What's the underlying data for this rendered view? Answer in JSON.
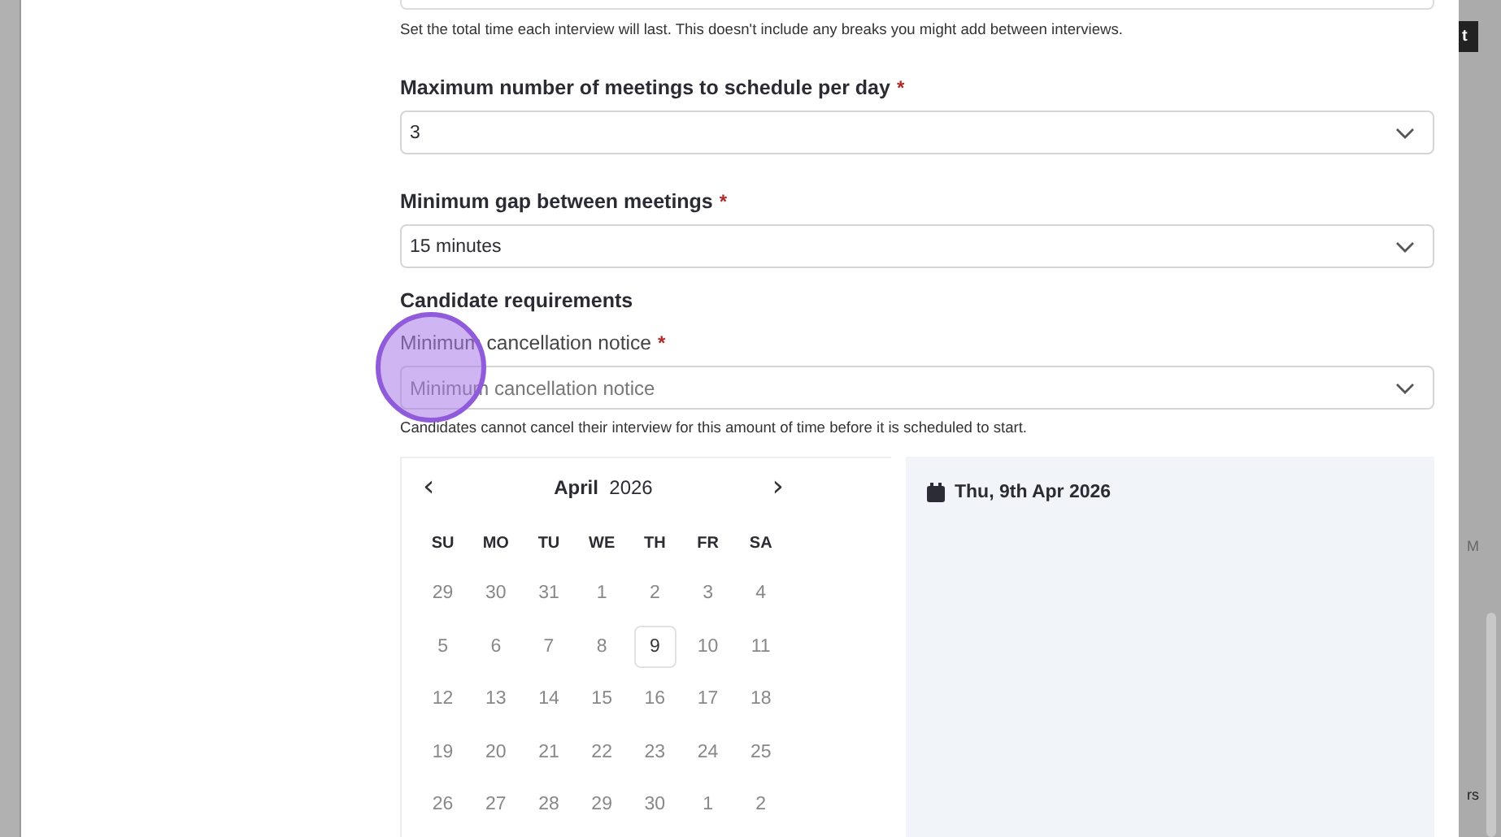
{
  "duration_hint": "Set the total time each interview will last. This doesn't include any breaks you might add between interviews.",
  "fields": [
    {
      "label": "Maximum number of meetings to schedule per day",
      "required_mark": "*",
      "value": "3"
    },
    {
      "label": "Minimum gap between meetings",
      "required_mark": "*",
      "value": "15 minutes"
    }
  ],
  "section_title": "Candidate requirements",
  "cancellation": {
    "label": "Minimum cancellation notice",
    "required_mark": "*",
    "placeholder": "Minimum cancellation notice",
    "hint": "Candidates cannot cancel their interview for this amount of time before it is scheduled to start."
  },
  "calendar": {
    "month": "April",
    "year": "2026",
    "prev": "‹",
    "next": "›",
    "weekdays": [
      "SU",
      "MO",
      "TU",
      "WE",
      "TH",
      "FR",
      "SA"
    ],
    "weeks": [
      [
        {
          "day": "29",
          "selected": false
        },
        {
          "day": "30",
          "selected": false
        },
        {
          "day": "31",
          "selected": false
        },
        {
          "day": "1",
          "selected": false
        },
        {
          "day": "2",
          "selected": false
        },
        {
          "day": "3",
          "selected": false
        },
        {
          "day": "4",
          "selected": false
        }
      ],
      [
        {
          "day": "5",
          "selected": false
        },
        {
          "day": "6",
          "selected": false
        },
        {
          "day": "7",
          "selected": false
        },
        {
          "day": "8",
          "selected": false
        },
        {
          "day": "9",
          "selected": true
        },
        {
          "day": "10",
          "selected": false
        },
        {
          "day": "11",
          "selected": false
        }
      ],
      [
        {
          "day": "12",
          "selected": false
        },
        {
          "day": "13",
          "selected": false
        },
        {
          "day": "14",
          "selected": false
        },
        {
          "day": "15",
          "selected": false
        },
        {
          "day": "16",
          "selected": false
        },
        {
          "day": "17",
          "selected": false
        },
        {
          "day": "18",
          "selected": false
        }
      ],
      [
        {
          "day": "19",
          "selected": false
        },
        {
          "day": "20",
          "selected": false
        },
        {
          "day": "21",
          "selected": false
        },
        {
          "day": "22",
          "selected": false
        },
        {
          "day": "23",
          "selected": false
        },
        {
          "day": "24",
          "selected": false
        },
        {
          "day": "25",
          "selected": false
        }
      ],
      [
        {
          "day": "26",
          "selected": false
        },
        {
          "day": "27",
          "selected": false
        },
        {
          "day": "28",
          "selected": false
        },
        {
          "day": "29",
          "selected": false
        },
        {
          "day": "30",
          "selected": false
        },
        {
          "day": "1",
          "selected": false
        },
        {
          "day": "2",
          "selected": false
        }
      ]
    ]
  },
  "selected_date": "Thu, 9th Apr 2026",
  "backdrop": {
    "button_fragment": "t",
    "text_fragments": [
      "M",
      "rs"
    ]
  }
}
